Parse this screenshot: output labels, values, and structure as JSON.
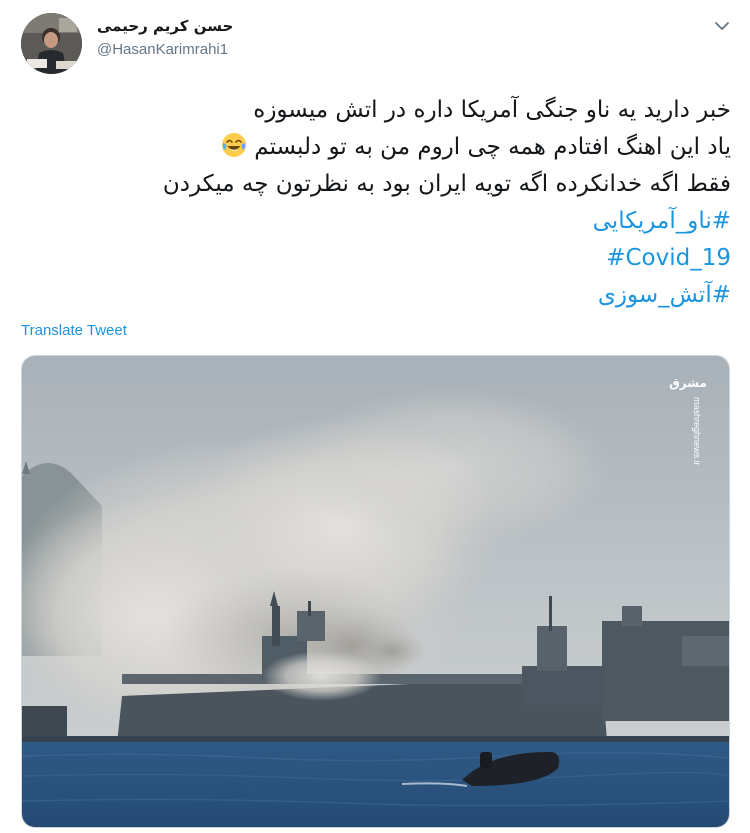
{
  "tweet": {
    "author": {
      "display_name": "حسن کریم رحیمی",
      "handle": "@HasanKarimrahi1"
    },
    "lines": [
      "خبر دارید یه ناو جنگی آمریکا داره در اتش میسوزه",
      "یاد این اهنگ افتادم  همه چی اروم من به تو دلبستم",
      "فقط اگه خدانکرده اگه تویه ایران بود  به نظرتون چه میکردن"
    ],
    "emoji": "face-with-tears-of-joy",
    "hashtags": [
      "#ناو_آمریکایی",
      "#Covid_19",
      "#آتش_سوزی"
    ],
    "translate_label": "Translate Tweet",
    "media": {
      "watermark_brand": "مشرق",
      "watermark_url": "mashreghnews.ir"
    }
  },
  "colors": {
    "link": "#1b95e0",
    "text": "#14171a",
    "secondary": "#657786",
    "border": "#ccd6dd"
  }
}
